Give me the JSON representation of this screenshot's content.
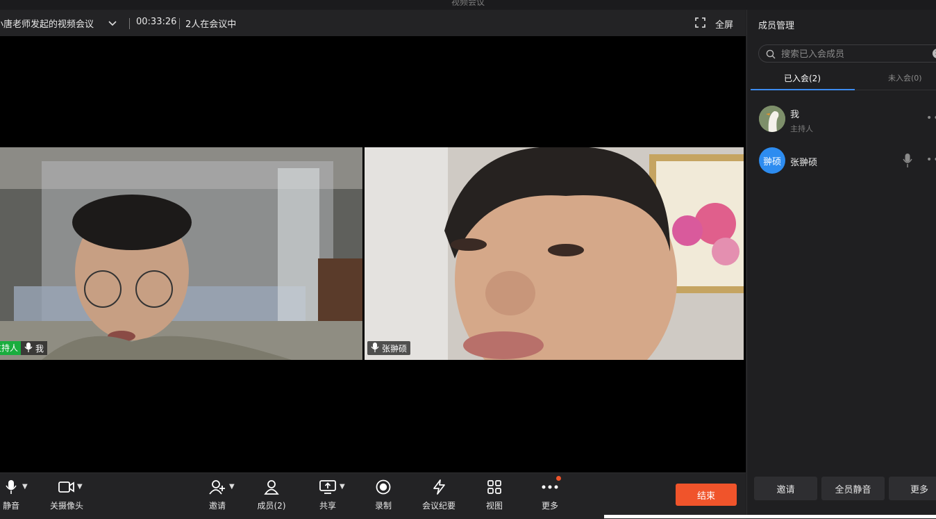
{
  "window": {
    "title": "视频会议"
  },
  "meeting_bar": {
    "title": "小唐老师发起的视频会议",
    "duration": "00:33:26",
    "participants_text": "2人在会议中",
    "fullscreen_label": "全屏"
  },
  "videos": [
    {
      "role_tag": "主持人",
      "name": "我"
    },
    {
      "name": "张翀硕"
    }
  ],
  "toolbar": {
    "mute": "静音",
    "camera_off": "关摄像头",
    "invite": "邀请",
    "members": "成员(2)",
    "share": "共享",
    "record": "录制",
    "minutes": "会议纪要",
    "view": "视图",
    "more": "更多",
    "end": "结束"
  },
  "panel": {
    "title": "成员管理",
    "search_placeholder": "搜索已入会成员",
    "tabs": [
      {
        "label": "已入会(2)"
      },
      {
        "label": "未入会(0)"
      }
    ],
    "members": [
      {
        "name": "我",
        "role": "主持人"
      },
      {
        "name": "张翀硕",
        "avatar_text": "翀硕"
      }
    ],
    "buttons": {
      "invite": "邀请",
      "mute_all": "全员静音",
      "more": "更多"
    }
  },
  "colors": {
    "accent": "#3d8cf0",
    "end_button": "#f0542b",
    "host_tag": "#1aad3e",
    "notification_dot": "#f0542b"
  }
}
